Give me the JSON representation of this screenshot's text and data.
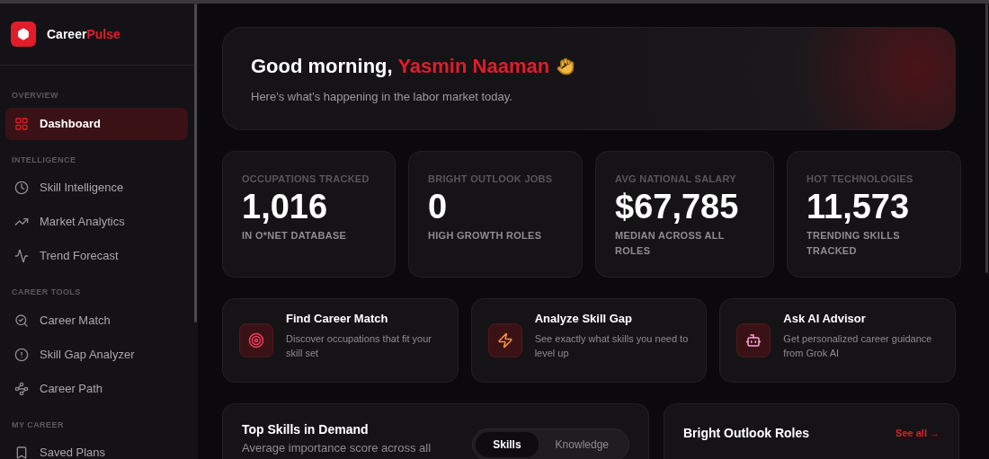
{
  "brand": {
    "first": "Career",
    "second": "Pulse"
  },
  "sidebar": {
    "sections": [
      {
        "label": "OVERVIEW",
        "items": [
          {
            "label": "Dashboard",
            "kind": "grid",
            "selected": true
          }
        ]
      },
      {
        "label": "INTELLIGENCE",
        "items": [
          {
            "label": "Skill Intelligence",
            "kind": "clock",
            "selected": false
          },
          {
            "label": "Market Analytics",
            "kind": "trend",
            "selected": false
          },
          {
            "label": "Trend Forecast",
            "kind": "forecast",
            "selected": false
          }
        ]
      },
      {
        "label": "CAREER TOOLS",
        "items": [
          {
            "label": "Career Match",
            "kind": "match",
            "selected": false
          },
          {
            "label": "Skill Gap Analyzer",
            "kind": "gap",
            "selected": false
          },
          {
            "label": "Career Path",
            "kind": "path",
            "selected": false
          }
        ]
      },
      {
        "label": "MY CAREER",
        "items": [
          {
            "label": "Saved Plans",
            "kind": "saved",
            "selected": false
          }
        ]
      }
    ]
  },
  "greeting": {
    "prefix": "Good morning,",
    "name": "Yasmin Naaman",
    "subtitle": "Here's what's happening in the labor market today."
  },
  "stats": [
    {
      "label": "OCCUPATIONS TRACKED",
      "value": "1,016",
      "caption": "IN O*NET DATABASE"
    },
    {
      "label": "BRIGHT OUTLOOK JOBS",
      "value": "0",
      "caption": "HIGH GROWTH ROLES"
    },
    {
      "label": "AVG NATIONAL SALARY",
      "value": "$67,785",
      "caption": "MEDIAN ACROSS ALL ROLES"
    },
    {
      "label": "HOT TECHNOLOGIES",
      "value": "11,573",
      "caption": "TRENDING SKILLS TRACKED"
    }
  ],
  "actions": [
    {
      "kind": "target",
      "title": "Find Career Match",
      "description": "Discover occupations that fit your skill set"
    },
    {
      "kind": "bolt",
      "title": "Analyze Skill Gap",
      "description": "See exactly what skills you need to level up"
    },
    {
      "kind": "robot",
      "title": "Ask AI Advisor",
      "description": "Get personalized career guidance from Grok AI"
    }
  ],
  "top_skills": {
    "title": "Top Skills in Demand",
    "subtitle": "Average importance score across all",
    "tabs": [
      {
        "label": "Skills",
        "selected": true
      },
      {
        "label": "Knowledge",
        "selected": false
      }
    ]
  },
  "bright_outlook": {
    "title": "Bright Outlook Roles",
    "link": "See all →"
  }
}
